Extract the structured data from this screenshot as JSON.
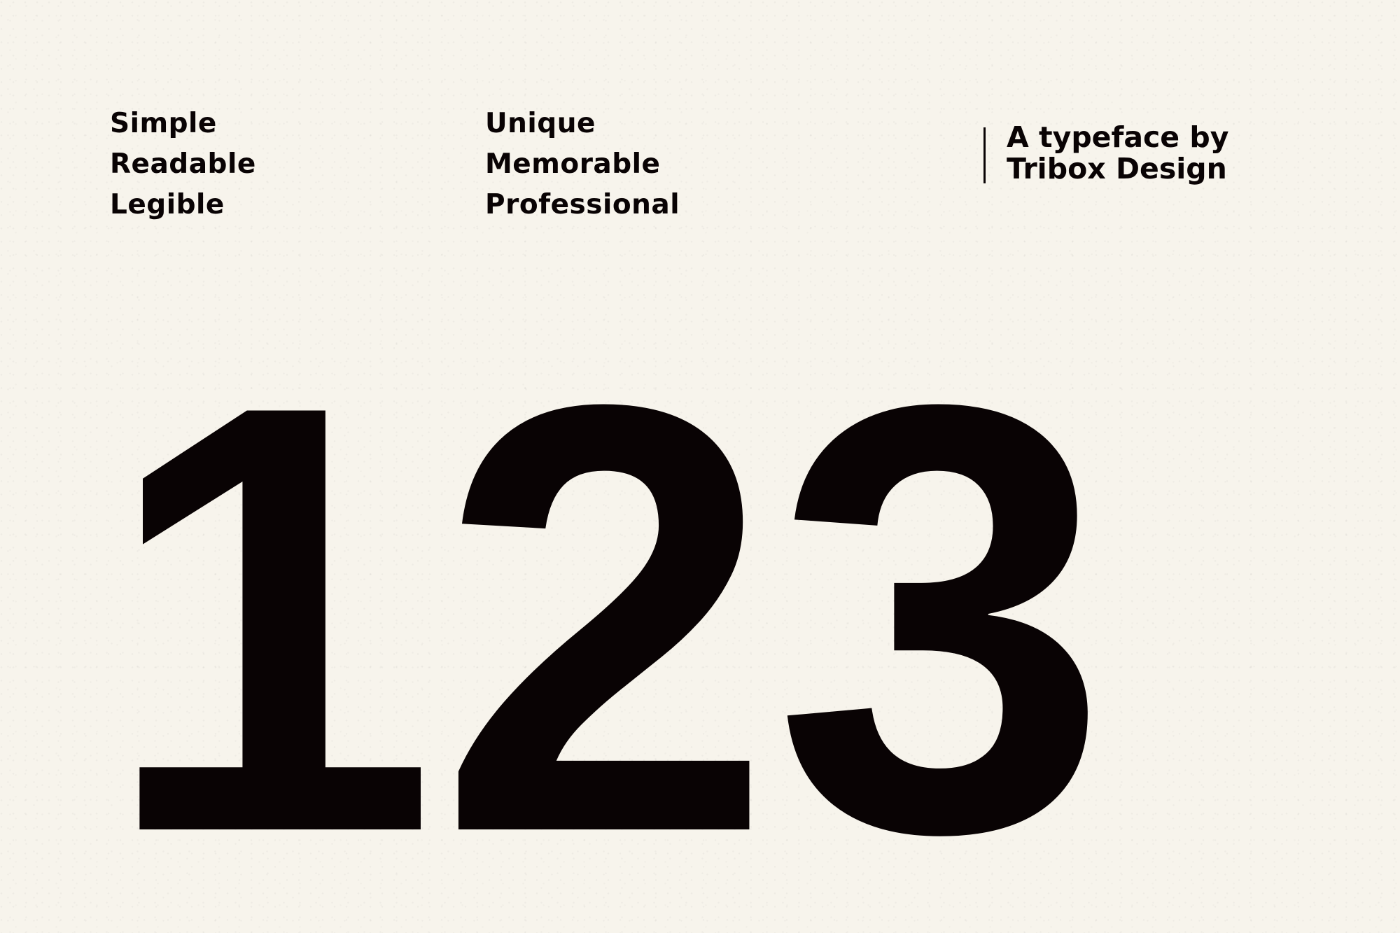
{
  "features": {
    "column_1": [
      "Simple",
      "Readable",
      "Legible"
    ],
    "column_2": [
      "Unique",
      "Memorable",
      "Professional"
    ]
  },
  "credit": {
    "line_1": "A typeface by",
    "line_2": "Tribox Design"
  },
  "showcase": {
    "digits": "123"
  },
  "colors": {
    "background": "#f7f4ec",
    "ink": "#090304"
  }
}
